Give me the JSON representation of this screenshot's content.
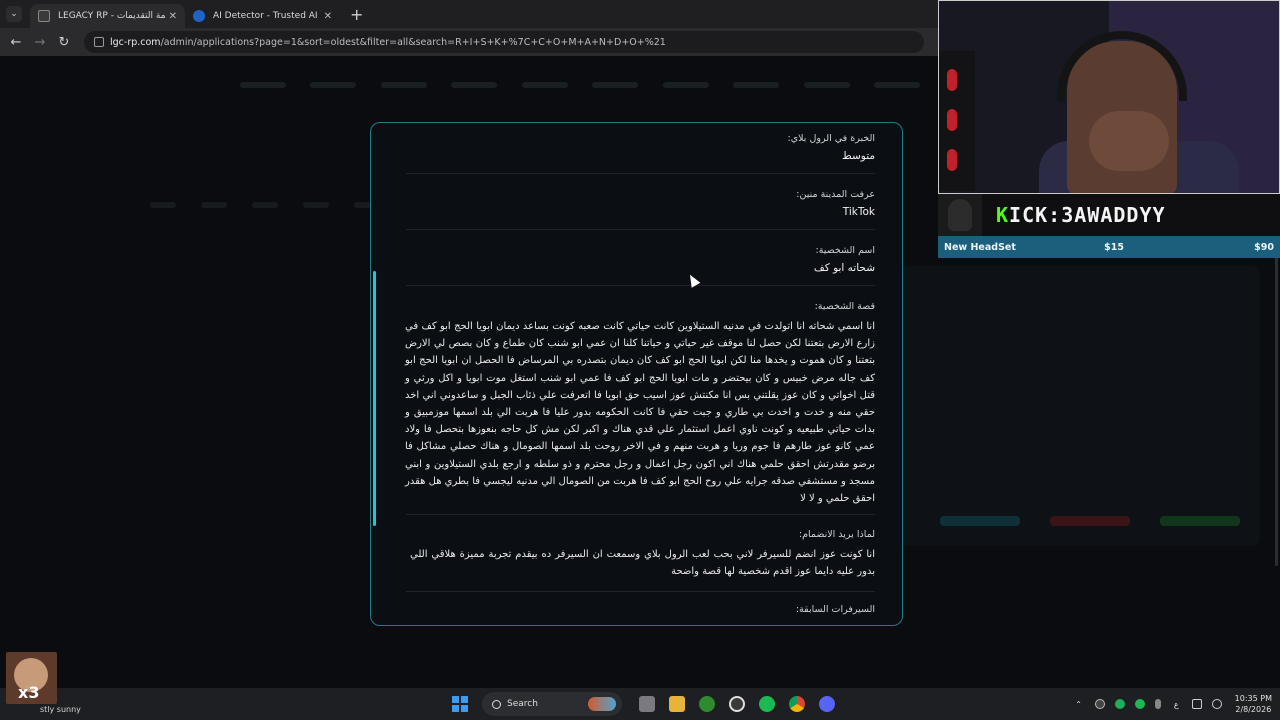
{
  "browser": {
    "tabs": [
      {
        "title": "LEGACY RP - قائمة التقديمات",
        "active": true
      },
      {
        "title": "AI Detector - Trusted AI Checke",
        "active": false
      }
    ],
    "close_glyph": "✕",
    "new_tab_glyph": "+",
    "tab_menu_glyph": "⌄",
    "url_host": "lgc-rp.com",
    "url_path": "/admin/applications?page=1&sort=oldest&filter=all&search=R+I+S+K+%7C+C+O+M+A+N+D+O+%21",
    "nav": {
      "back": "←",
      "forward": "→",
      "reload": "↻"
    }
  },
  "application": {
    "rp_experience": {
      "label": "الخبرة في الرول بلاي:",
      "value": "متوسط"
    },
    "city_source": {
      "label": "عرفت المدينة منين:",
      "value": "TikTok"
    },
    "character_name": {
      "label": "اسم الشخصية:",
      "value": "شحاته ابو كف"
    },
    "character_story": {
      "label": "قصة الشخصية:",
      "value": "انا اسمي شحاته انا اتولدت في مدنيه الستيلاوين كانت حياتي كانت صعبه كونت بساعد ديمان ابويا الحج ابو كف في زارع الارض بتعتنا لكن حصل لنا موقف غير حياتي و حياتنا كلنا ان عمي ابو شنب كان طماع و كان بصص لي الارض بتعتنا و كان هموت و يخدها منا لكن ابويا الحج ابو كف كان ديمان بتصدره بي المرساض فا الحصل ان ابويا الحج ابو كف جاله مرض خبيس و كان بيحتضر و مات ابويا الحج ابو كف فا عمي ابو شنب استغل موت ابويا و اكل ورثي و قتل اخواتي و كان عوز يقلتني بس انا مكنتش عوز اسيب حق ابويا فا اتعرفت علي ذئاب الجبل و ساعدوني اني اخد حقي منه و خدت و اخدت بي طاري و جبت حقي فا كانت الحكومه بدور عليا فا هربت الي بلد اسمها موزمبيق و بدات حياتي طبيعيه و كونت ناوي اعمل استثمار علي قدي هناك و اكبر لكن مش كل حاجه بنعوزها بتحصل فا ولاد عمي كانو عوز طارهم فا جوم وريا و هربت منهم و في الاخر روحت بلد اسمها الصومال و هناك حصلي مشاكل فا برضو مقدرتش احقق حلمي هناك اني اكون رجل اعمال و رجل محترم و ذو سلطه و ارجع بلدي الستيلاوين و ابني مسجد و مستشفي صدقه جرايه علي روح الحج ابو كف فا هربت من الصومال الي مدنيه ليجسي فا بطري هل هقدر احقق حلمي و لا لا"
    },
    "join_reason": {
      "label": "لماذا يريد الانضمام:",
      "value": "انا كونت عوز انضم للسيرفر لاني بحب لعب الرول بلاي وسمعت ان السيرفر ده بيقدم تجربة مميزة هلاقي اللي بدور عليه دايما عوز اقدم شخصية لها قصة واضحة"
    },
    "previous_servers": {
      "label": "السيرفرات السابقة:"
    }
  },
  "overlay": {
    "kick_channel": "3AWADDYY",
    "kick_prefix": "K",
    "kick_rest": "ICK:",
    "goal_name": "New HeadSet",
    "goal_current": "$15",
    "goal_target": "$90"
  },
  "taskbar": {
    "weather_badge": "x3",
    "weather_text": "stly sunny",
    "search_label": "Search",
    "lang": "ع",
    "time": "10:35 PM",
    "date": "2/8/2026"
  },
  "colors": {
    "accent": "#26c6d6",
    "kick_green": "#53fc18",
    "goal_bar": "#1c5f7c"
  }
}
